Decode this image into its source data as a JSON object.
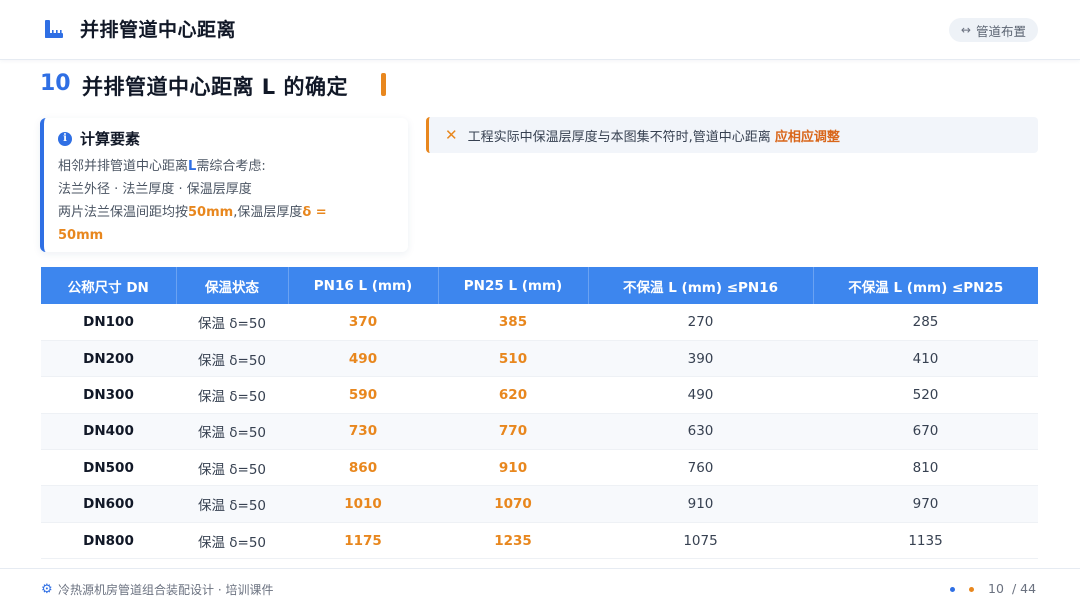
{
  "header": {
    "title": "并排管道中心距离",
    "nav_label": "管道布置",
    "nav_icon": "left-right-arrow-icon"
  },
  "section": {
    "number": "10",
    "title": "并排管道中心距离 L 的确定"
  },
  "info_card": {
    "title": "计算要素",
    "line1_prefix": "相邻并排管道中心距离",
    "line1_highlight": "L",
    "line1_suffix": "需综合考虑:",
    "line2": "法兰外径 · 法兰厚度 · 保温层厚度",
    "line3_prefix": "两片法兰保温间距均按",
    "line3_highlight1": "50mm",
    "line3_middle": ",保温层厚度",
    "line3_highlight2": "δ =",
    "line4_highlight": "50mm"
  },
  "tip": {
    "text": "工程实际中保温层厚度与本图集不符时,管道中心距离 ",
    "strong": "应相应调整"
  },
  "table": {
    "headers": [
      "公称尺寸 DN",
      "保温状态",
      "PN16 L (mm)",
      "PN25 L (mm)",
      "不保温 L (mm) ≤PN16",
      "不保温 L (mm) ≤PN25"
    ],
    "rows": [
      [
        "DN100",
        "保温 δ=50",
        "370",
        "385",
        "270",
        "285"
      ],
      [
        "DN200",
        "保温 δ=50",
        "490",
        "510",
        "390",
        "410"
      ],
      [
        "DN300",
        "保温 δ=50",
        "590",
        "620",
        "490",
        "520"
      ],
      [
        "DN400",
        "保温 δ=50",
        "730",
        "770",
        "630",
        "670"
      ],
      [
        "DN500",
        "保温 δ=50",
        "860",
        "910",
        "760",
        "810"
      ],
      [
        "DN600",
        "保温 δ=50",
        "1010",
        "1070",
        "910",
        "970"
      ],
      [
        "DN800",
        "保温 δ=50",
        "1175",
        "1235",
        "1075",
        "1135"
      ]
    ]
  },
  "footer": {
    "text": "冷热源机房管道组合装配设计 · 培训课件",
    "page_current": "10",
    "page_total": "/ 44"
  },
  "colors": {
    "primary": "#2f6fe4",
    "accent": "#e8871e",
    "table_header": "#3d86ee"
  }
}
